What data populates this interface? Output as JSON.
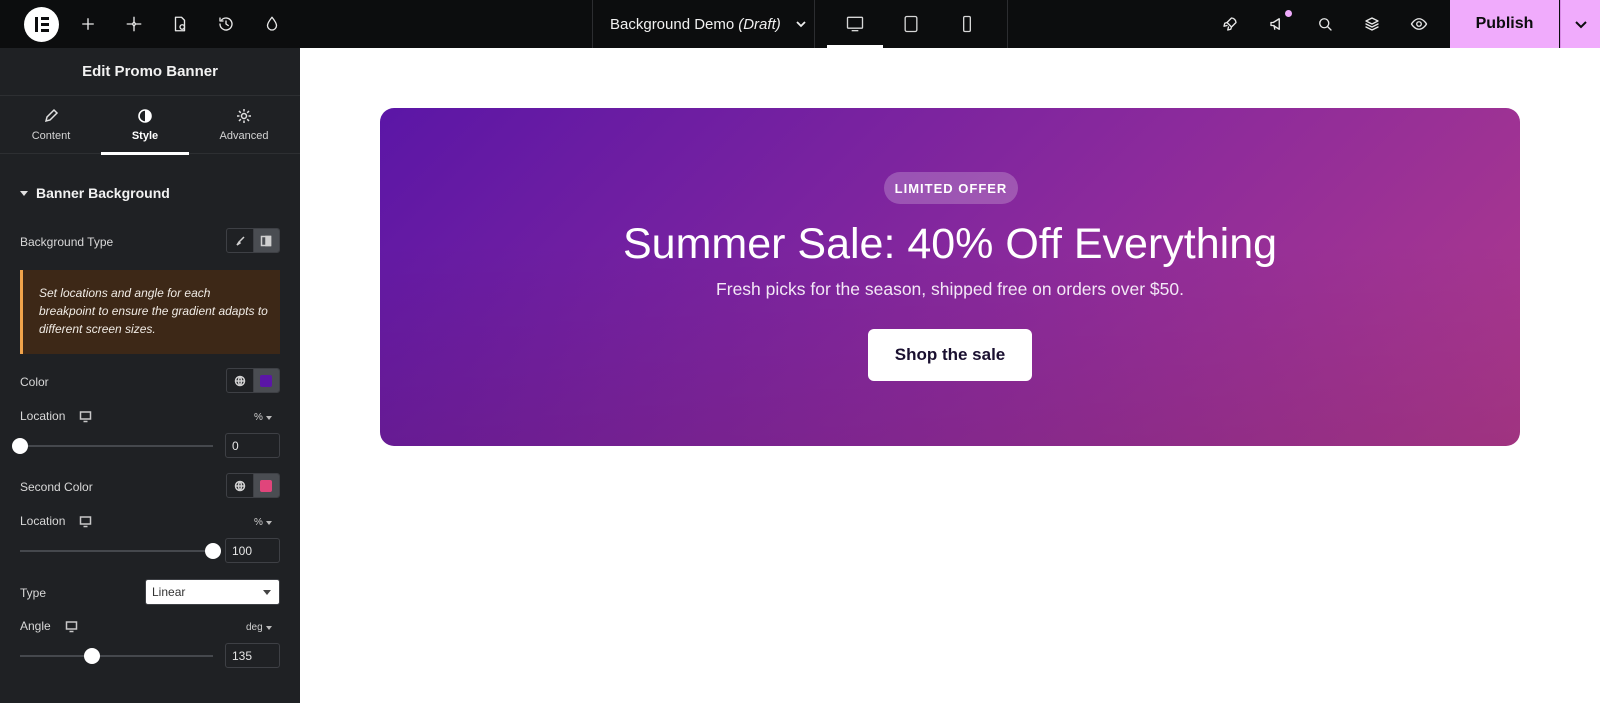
{
  "topbar": {
    "document_title": "Background Demo",
    "document_status": "(Draft)",
    "publish_label": "Publish",
    "icons": [
      "elementor-logo-icon",
      "add-icon",
      "sparkle-icon",
      "page-settings-icon",
      "history-icon",
      "theme-drop-icon",
      "desktop-icon",
      "tablet-icon",
      "mobile-icon",
      "rocket-icon",
      "megaphone-icon",
      "search-icon",
      "layers-icon",
      "preview-eye-icon"
    ],
    "accent_color": "#f0abfc"
  },
  "panel": {
    "title": "Edit Promo Banner",
    "tabs": [
      {
        "label": "Content",
        "icon": "pencil-icon"
      },
      {
        "label": "Style",
        "icon": "half-circle-icon",
        "active": true
      },
      {
        "label": "Advanced",
        "icon": "gear-icon"
      }
    ],
    "section_title": "Banner Background",
    "background_type_label": "Background Type",
    "notice": "Set locations and angle for each breakpoint to ensure the gradient adapts to different screen sizes.",
    "color_label": "Color",
    "color_value": "#5b16a6",
    "location1_label": "Location",
    "location1_unit": "%",
    "location1_value": "0",
    "location1_fraction": 0,
    "second_color_label": "Second Color",
    "second_color_value": "#e0457b",
    "location2_label": "Location",
    "location2_unit": "%",
    "location2_value": "100",
    "location2_fraction": 1,
    "type_label": "Type",
    "type_value": "Linear",
    "angle_label": "Angle",
    "angle_unit": "deg",
    "angle_value": "135",
    "angle_fraction": 0.375
  },
  "banner": {
    "badge": "LIMITED OFFER",
    "headline": "Summer Sale: 40% Off Everything",
    "subline": "Fresh picks for the season, shipped free on orders over $50.",
    "cta_label": "Shop the sale"
  }
}
